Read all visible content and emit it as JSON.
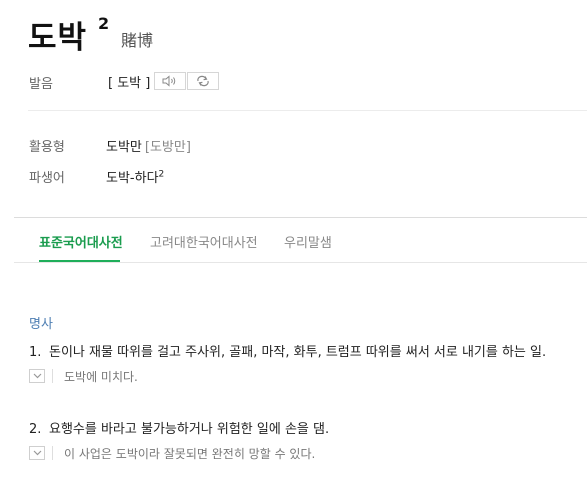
{
  "entry": {
    "word": "도박",
    "superscript": "2",
    "hanja": "賭博"
  },
  "pronunciation": {
    "label": "발음",
    "text": "[ 도박 ]",
    "speaker_icon": "speaker-icon",
    "repeat_icon": "repeat-icon"
  },
  "forms": {
    "conjugation_label": "활용형",
    "conjugation_value": "도박만",
    "conjugation_pron": "[도방만]",
    "derivative_label": "파생어",
    "derivative_value": "도박-하다",
    "derivative_sup": "2"
  },
  "tabs": [
    {
      "label": "표준국어대사전",
      "active": true
    },
    {
      "label": "고려대한국어대사전",
      "active": false
    },
    {
      "label": "우리말샘",
      "active": false
    }
  ],
  "definitions": {
    "pos": "명사",
    "items": [
      {
        "num": "1.",
        "text": "돈이나 재물 따위를 걸고 주사위, 골패, 마작, 화투, 트럼프 따위를 써서 서로 내기를 하는 일.",
        "example": "도박에 미치다."
      },
      {
        "num": "2.",
        "text": "요행수를 바라고 불가능하거나 위험한 일에 손을 댐.",
        "example": "이 사업은 도박이라 잘못되면 완전히 망할 수 있다."
      }
    ]
  },
  "colors": {
    "accent": "#1fae5a",
    "pos": "#4f7fb3"
  }
}
